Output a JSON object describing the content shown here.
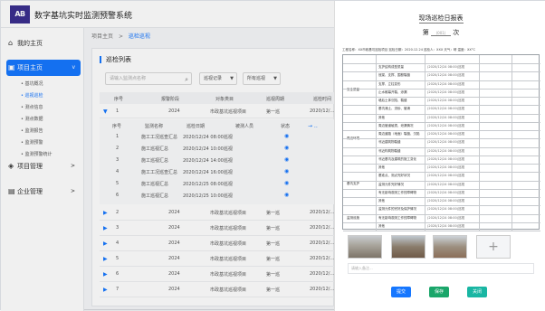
{
  "app": {
    "logo_text": "AB",
    "title": "数字基坑实时监测预警系统"
  },
  "sidebar": {
    "items": [
      {
        "label": "我的主页",
        "icon": "home-icon"
      },
      {
        "label": "项目主页",
        "icon": "project-icon",
        "chevron": "v"
      },
      {
        "label": "项目管理",
        "icon": "layers-icon",
        "chevron": ">"
      },
      {
        "label": "企业管理",
        "icon": "enterprise-icon",
        "chevron": ">"
      }
    ],
    "sub_items": [
      "• 基坑概况",
      "• 巡视巡检",
      "• 测点信息",
      "• 测点数据",
      "• 监测报告",
      "• 监测预警",
      "• 监测预警统计"
    ]
  },
  "breadcrumb": {
    "root": "项目主页",
    "sep": ">",
    "current": "巡检巡视"
  },
  "panel": {
    "title": "巡检列表",
    "search_placeholder": "请输入监测点名称",
    "filter1": "巡视记录",
    "filter2": "所有巡视",
    "headers": [
      "序号",
      "报警阶段",
      "对象类目",
      "巡视周期",
      "巡检时间"
    ],
    "row1": {
      "index": "1",
      "year": "2024",
      "target": "市政基坑巡视项目",
      "cycle": "第一巡",
      "time": "2020/12/…"
    },
    "sub_headers": [
      "序号",
      "监测名称",
      "巡检日期",
      "被测人员",
      "状态"
    ],
    "sub_rows": [
      [
        "1",
        "施工工况巡查汇总",
        "2020/12/24 08:00巡视"
      ],
      [
        "2",
        "施工巡视汇总",
        "2020/12/24 10:00巡视"
      ],
      [
        "3",
        "施工巡视汇总",
        "2020/12/24 14:00巡视"
      ],
      [
        "4",
        "施工工况巡查汇总",
        "2020/12/24 16:00巡视"
      ],
      [
        "5",
        "施工巡视汇总",
        "2020/12/25 08:00巡视"
      ],
      [
        "6",
        "施工巡视汇总",
        "2020/12/25 10:00巡视"
      ]
    ],
    "rows": [
      {
        "index": "2",
        "year": "2024",
        "target": "市政基坑巡视项目",
        "cycle": "第一巡",
        "time": "2020/12/…"
      },
      {
        "index": "3",
        "year": "2024",
        "target": "市政基坑巡视项目",
        "cycle": "第一巡",
        "time": "2020/12/…"
      },
      {
        "index": "4",
        "year": "2024",
        "target": "市政基坑巡视项目",
        "cycle": "第一巡",
        "time": "2020/12/…"
      },
      {
        "index": "5",
        "year": "2024",
        "target": "市政基坑巡视项目",
        "cycle": "第一巡",
        "time": "2020/12/…"
      },
      {
        "index": "6",
        "year": "2024",
        "target": "市政基坑巡视项目",
        "cycle": "第一巡",
        "time": "2020/12/…"
      },
      {
        "index": "7",
        "year": "2024",
        "target": "市政基坑巡视项目",
        "cycle": "第一巡",
        "time": "2020/12/…"
      }
    ]
  },
  "drawer": {
    "title": "现场巡检日报表",
    "sub_prefix": "第",
    "sub_blank": "(001)",
    "sub_suffix": "次",
    "meta": "工程名称：XX市政基坑巡检项目   巡检日期：2020.12.24   巡检人：XXX   天气：晴   温度：XX°C",
    "sheet_groups": [
      "安全质量",
      "周边环境",
      "基坑支护",
      "监测设施"
    ],
    "sheet_rows": [
      "支护结构成型质量",
      "冠梁、支撑、围檩裂缝",
      "支撑、立柱变形",
      "止水帷幕开裂、渗漏",
      "墙后土体沉陷、裂缝",
      "基坑涌土、流砂、管涌",
      "其他",
      "周边管道破损、泄漏情况",
      "周边道路（地面）裂缝、沉陷",
      "邻近建筑物裂缝",
      "邻近构筑物裂缝",
      "邻近基坑及建筑的施工变化",
      "其他",
      "基准点、测点完好状况",
      "监测元件完好情况",
      "有无影响观测工作的障碍物",
      "其他",
      "监测元件的完好及保护情况",
      "有无影响观测工作的障碍物",
      "其他"
    ],
    "sheet_row_tail": "(2020/12/24 08:00)巡视",
    "remark_placeholder": "请输入备注...",
    "photo_add": "+",
    "buttons": [
      "提交",
      "保存",
      "关闭"
    ]
  },
  "colors": {
    "accent": "#1677ff",
    "approve": "#1aa66a",
    "close": "#19b6a3"
  }
}
